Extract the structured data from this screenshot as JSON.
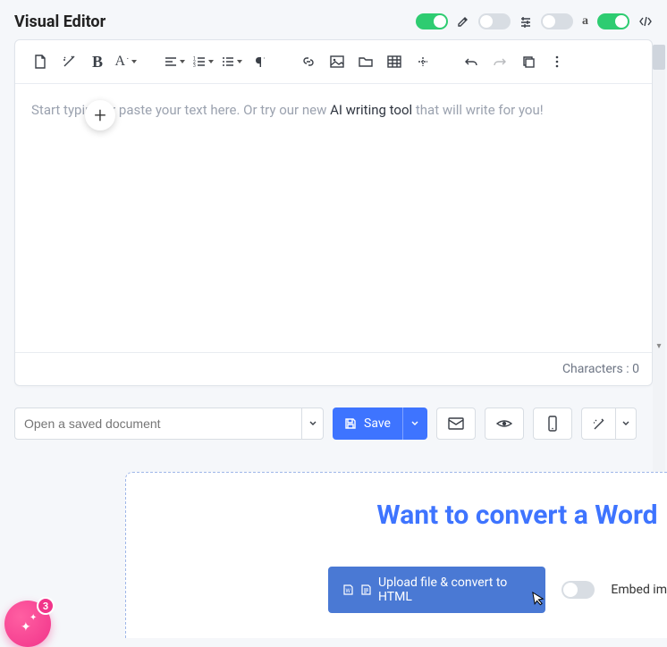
{
  "header": {
    "title": "Visual Editor",
    "toggles": [
      {
        "name": "toggle-1",
        "state": "on"
      },
      {
        "name": "toggle-2",
        "state": "off"
      },
      {
        "name": "toggle-3",
        "state": "off"
      },
      {
        "name": "toggle-4",
        "state": "on"
      }
    ],
    "icons": [
      "edit-icon",
      "sliders-icon",
      "amazon-icon",
      "code-icon"
    ]
  },
  "toolbar": {
    "groups": [
      "file",
      "magic",
      "bold",
      "font-size",
      "align",
      "list-ordered",
      "list-bullets",
      "paragraph",
      "link",
      "image",
      "folder",
      "table",
      "insert",
      "undo",
      "redo",
      "copy",
      "more"
    ]
  },
  "editor": {
    "placeholder_pre": "Start typing or paste your text here. Or try our new ",
    "placeholder_strong": "AI writing tool",
    "placeholder_post": " that will write for you!",
    "characters_label": "Characters :",
    "characters_value": "0"
  },
  "controls": {
    "open_placeholder": "Open a saved document",
    "save_label": "Save"
  },
  "convert": {
    "heading": "Want to convert a Word",
    "upload_label": "Upload file & convert to HTML",
    "embed_label": "Embed im"
  },
  "fab": {
    "badge": "3"
  }
}
